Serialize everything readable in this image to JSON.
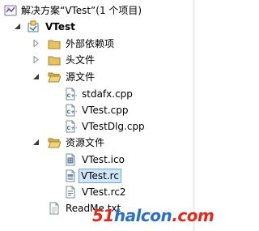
{
  "tree": {
    "solution": {
      "label": "解决方案“VTest”(1 个项目)",
      "icon": "solution-icon"
    },
    "project": {
      "label": "VTest",
      "icon": "vc-project-icon"
    },
    "external_deps": {
      "label": "外部依赖项",
      "icon": "folder-icon"
    },
    "headers": {
      "label": "头文件",
      "icon": "folder-icon"
    },
    "sources": {
      "label": "源文件",
      "icon": "folder-open-icon",
      "children": [
        {
          "label": "stdafx.cpp",
          "icon": "cpp-file-icon"
        },
        {
          "label": "VTest.cpp",
          "icon": "cpp-file-icon"
        },
        {
          "label": "VTestDlg.cpp",
          "icon": "cpp-file-icon"
        }
      ]
    },
    "resources": {
      "label": "资源文件",
      "icon": "folder-open-icon",
      "children": [
        {
          "label": "VTest.ico",
          "icon": "ico-file-icon"
        },
        {
          "label": "VTest.rc",
          "icon": "rc-file-icon",
          "selected": true
        },
        {
          "label": "VTest.rc2",
          "icon": "rc2-file-icon"
        }
      ]
    },
    "readme": {
      "label": "ReadMe.txt",
      "icon": "text-file-icon"
    }
  },
  "watermark": {
    "text_a": "51",
    "text_b": "halcon",
    "text_c": ".com"
  },
  "colors": {
    "selection_fill": "#cfe6fb",
    "selection_border": "#6fa7da",
    "folder": "#e8c25e",
    "watermark_red": "#e8271b",
    "watermark_blue": "#2a6fc9"
  }
}
